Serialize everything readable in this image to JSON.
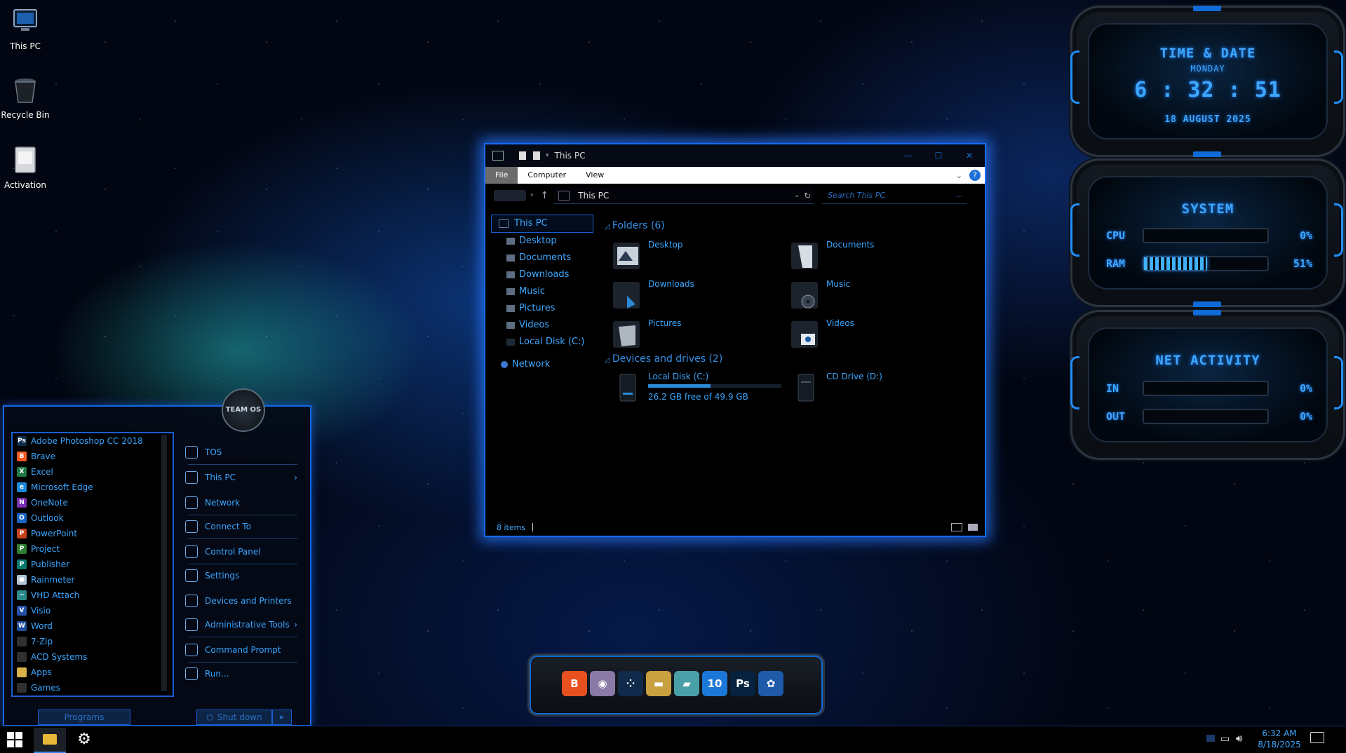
{
  "desktop": {
    "icons": [
      {
        "label": "This PC"
      },
      {
        "label": "Recycle Bin"
      },
      {
        "label": "Activation"
      }
    ]
  },
  "explorer": {
    "title": "This PC",
    "ribbon_tabs": [
      "File",
      "Computer",
      "View"
    ],
    "address": "This PC",
    "search_placeholder": "Search This PC",
    "nav": [
      {
        "label": "This PC"
      },
      {
        "label": "Desktop"
      },
      {
        "label": "Documents"
      },
      {
        "label": "Downloads"
      },
      {
        "label": "Music"
      },
      {
        "label": "Pictures"
      },
      {
        "label": "Videos"
      },
      {
        "label": "Local Disk (C:)"
      },
      {
        "label": "Network"
      }
    ],
    "folders_header": "Folders (6)",
    "folders": [
      {
        "label": "Desktop"
      },
      {
        "label": "Documents"
      },
      {
        "label": "Downloads"
      },
      {
        "label": "Music"
      },
      {
        "label": "Pictures"
      },
      {
        "label": "Videos"
      }
    ],
    "drives_header": "Devices and drives (2)",
    "drives": [
      {
        "label": "Local Disk (C:)",
        "free": "26.2 GB free of 49.9 GB",
        "used_fraction": 0.47
      },
      {
        "label": "CD Drive (D:)"
      }
    ],
    "status": "8 items"
  },
  "start_menu": {
    "programs": [
      {
        "label": "Adobe Photoshop CC 2018",
        "badge": "Ps",
        "color": "#0d2b4a"
      },
      {
        "label": "Brave",
        "badge": "B",
        "color": "#f25a1f"
      },
      {
        "label": "Excel",
        "badge": "X",
        "color": "#1f7a45"
      },
      {
        "label": "Microsoft Edge",
        "badge": "e",
        "color": "#1a8ad8"
      },
      {
        "label": "OneNote",
        "badge": "N",
        "color": "#7a2fb0"
      },
      {
        "label": "Outlook",
        "badge": "O",
        "color": "#1565c0"
      },
      {
        "label": "PowerPoint",
        "badge": "P",
        "color": "#c8421c"
      },
      {
        "label": "Project",
        "badge": "P",
        "color": "#2e7d32"
      },
      {
        "label": "Publisher",
        "badge": "P",
        "color": "#0b7a6e"
      },
      {
        "label": "Rainmeter",
        "badge": "●",
        "color": "#b0c4d4"
      },
      {
        "label": "VHD Attach",
        "badge": "~",
        "color": "#2a8a8a"
      },
      {
        "label": "Visio",
        "badge": "V",
        "color": "#2450a8"
      },
      {
        "label": "Word",
        "badge": "W",
        "color": "#1c4f9c"
      },
      {
        "label": "7-Zip",
        "badge": "",
        "color": "#303030"
      },
      {
        "label": "ACD Systems",
        "badge": "",
        "color": "#303030"
      },
      {
        "label": "Apps",
        "badge": "",
        "color": "#d8b24a"
      },
      {
        "label": "Games",
        "badge": "",
        "color": "#303030"
      }
    ],
    "links": [
      {
        "label": "TOS",
        "arrow": ""
      },
      {
        "label": "This PC",
        "arrow": "›"
      },
      {
        "label": "Network",
        "arrow": ""
      },
      {
        "label": "Connect To",
        "arrow": ""
      },
      {
        "label": "Control Panel",
        "arrow": ""
      },
      {
        "label": "Settings",
        "arrow": ""
      },
      {
        "label": "Devices and Printers",
        "arrow": ""
      },
      {
        "label": "Administrative Tools",
        "arrow": "›"
      },
      {
        "label": "Command Prompt",
        "arrow": ""
      },
      {
        "label": "Run...",
        "arrow": ""
      }
    ],
    "programs_button": "Programs",
    "shutdown_button": "Shut down",
    "logo_text": "TEAM OS"
  },
  "gadgets": {
    "time": {
      "title": "TIME & DATE",
      "day": "MONDAY",
      "clock": "6 : 32 : 51",
      "date": "18 AUGUST 2025"
    },
    "system": {
      "title": "SYSTEM",
      "cpu_label": "CPU",
      "cpu_value": "0%",
      "cpu_fraction": 0.0,
      "ram_label": "RAM",
      "ram_value": "51%",
      "ram_fraction": 0.51
    },
    "net": {
      "title": "NET ACTIVITY",
      "in_label": "IN",
      "in_value": "0%",
      "in_fraction": 0.0,
      "out_label": "OUT",
      "out_value": "0%",
      "out_fraction": 0.0
    }
  },
  "dock": {
    "apps": [
      {
        "name": "brave-icon",
        "glyph": "B",
        "color": "#e8501f"
      },
      {
        "name": "disc-icon",
        "glyph": "◉",
        "color": "#8a7aa8"
      },
      {
        "name": "dots-icon",
        "glyph": "⁘",
        "color": "#0f2a4a"
      },
      {
        "name": "usb-drive-icon",
        "glyph": "▬",
        "color": "#c8a040"
      },
      {
        "name": "drive-icon",
        "glyph": "▰",
        "color": "#4aa0a8"
      },
      {
        "name": "win10-icon",
        "glyph": "10",
        "color": "#1c78d8"
      },
      {
        "name": "photoshop-icon",
        "glyph": "Ps",
        "color": "#06223e"
      },
      {
        "name": "camera-icon",
        "glyph": "✿",
        "color": "#1e5aa8"
      }
    ]
  },
  "taskbar": {
    "time": "6:32 AM",
    "date": "8/18/2025"
  }
}
